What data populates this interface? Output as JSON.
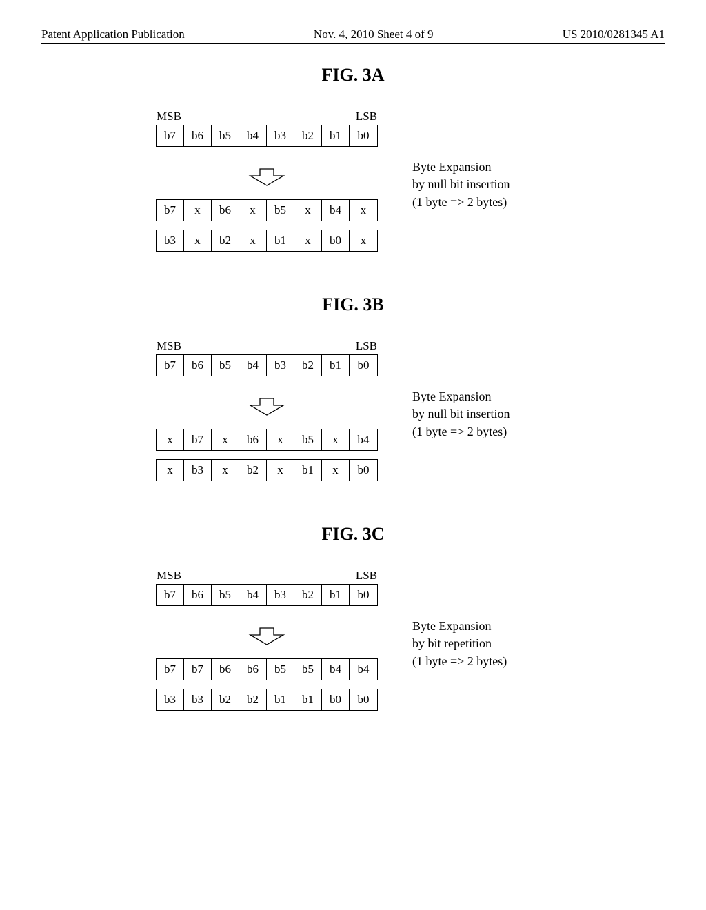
{
  "header": {
    "left": "Patent Application Publication",
    "mid": "Nov. 4, 2010  Sheet 4 of 9",
    "right": "US 2010/0281345 A1"
  },
  "figures": [
    {
      "title": "FIG. 3A",
      "msb": "MSB",
      "lsb": "LSB",
      "source_row": [
        "b7",
        "b6",
        "b5",
        "b4",
        "b3",
        "b2",
        "b1",
        "b0"
      ],
      "out_rows": [
        [
          "b7",
          "x",
          "b6",
          "x",
          "b5",
          "x",
          "b4",
          "x"
        ],
        [
          "b3",
          "x",
          "b2",
          "x",
          "b1",
          "x",
          "b0",
          "x"
        ]
      ],
      "desc_lines": [
        "Byte Expansion",
        "by null bit insertion",
        "(1 byte => 2 bytes)"
      ]
    },
    {
      "title": "FIG. 3B",
      "msb": "MSB",
      "lsb": "LSB",
      "source_row": [
        "b7",
        "b6",
        "b5",
        "b4",
        "b3",
        "b2",
        "b1",
        "b0"
      ],
      "out_rows": [
        [
          "x",
          "b7",
          "x",
          "b6",
          "x",
          "b5",
          "x",
          "b4"
        ],
        [
          "x",
          "b3",
          "x",
          "b2",
          "x",
          "b1",
          "x",
          "b0"
        ]
      ],
      "desc_lines": [
        "Byte Expansion",
        "by null bit insertion",
        "(1 byte => 2 bytes)"
      ]
    },
    {
      "title": "FIG. 3C",
      "msb": "MSB",
      "lsb": "LSB",
      "source_row": [
        "b7",
        "b6",
        "b5",
        "b4",
        "b3",
        "b2",
        "b1",
        "b0"
      ],
      "out_rows": [
        [
          "b7",
          "b7",
          "b6",
          "b6",
          "b5",
          "b5",
          "b4",
          "b4"
        ],
        [
          "b3",
          "b3",
          "b2",
          "b2",
          "b1",
          "b1",
          "b0",
          "b0"
        ]
      ],
      "desc_lines": [
        "Byte Expansion",
        "by bit repetition",
        "(1 byte => 2 bytes)"
      ]
    }
  ],
  "chart_data": {
    "type": "table",
    "note": "Three byte-expansion diagrams showing input byte (b7..b0) and two expanded output bytes each.",
    "figures": [
      {
        "id": "3A",
        "method": "null bit insertion (x after each bit)",
        "input": [
          "b7",
          "b6",
          "b5",
          "b4",
          "b3",
          "b2",
          "b1",
          "b0"
        ],
        "output_byte_1": [
          "b7",
          "x",
          "b6",
          "x",
          "b5",
          "x",
          "b4",
          "x"
        ],
        "output_byte_2": [
          "b3",
          "x",
          "b2",
          "x",
          "b1",
          "x",
          "b0",
          "x"
        ]
      },
      {
        "id": "3B",
        "method": "null bit insertion (x before each bit)",
        "input": [
          "b7",
          "b6",
          "b5",
          "b4",
          "b3",
          "b2",
          "b1",
          "b0"
        ],
        "output_byte_1": [
          "x",
          "b7",
          "x",
          "b6",
          "x",
          "b5",
          "x",
          "b4"
        ],
        "output_byte_2": [
          "x",
          "b3",
          "x",
          "b2",
          "x",
          "b1",
          "x",
          "b0"
        ]
      },
      {
        "id": "3C",
        "method": "bit repetition",
        "input": [
          "b7",
          "b6",
          "b5",
          "b4",
          "b3",
          "b2",
          "b1",
          "b0"
        ],
        "output_byte_1": [
          "b7",
          "b7",
          "b6",
          "b6",
          "b5",
          "b5",
          "b4",
          "b4"
        ],
        "output_byte_2": [
          "b3",
          "b3",
          "b2",
          "b2",
          "b1",
          "b1",
          "b0",
          "b0"
        ]
      }
    ]
  }
}
